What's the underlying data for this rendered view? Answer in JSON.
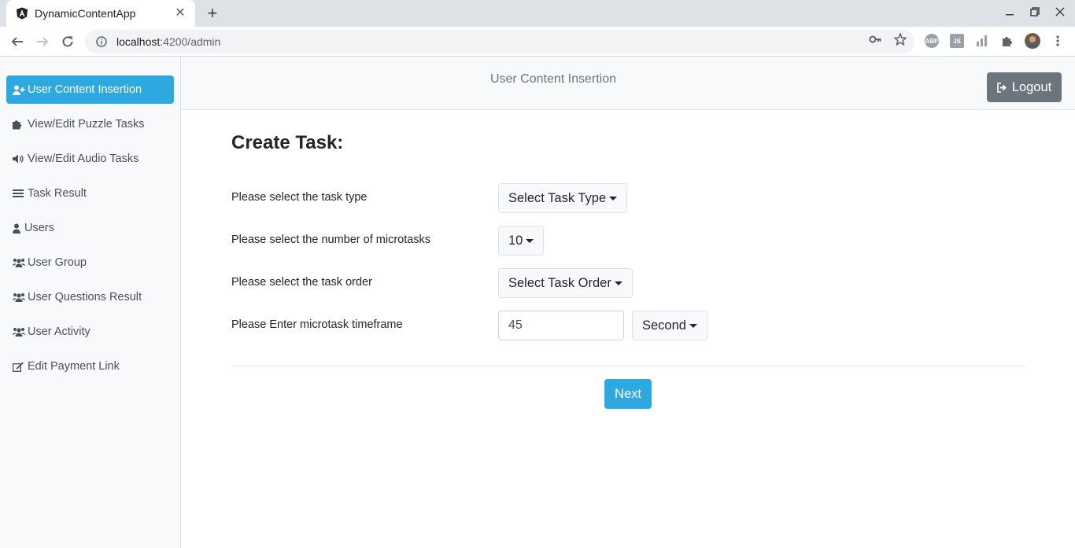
{
  "browser": {
    "tab_title": "DynamicContentApp",
    "tab_close": "✕",
    "new_tab": "+",
    "url_host": "localhost",
    "url_path": ":4200/admin",
    "extensions": [
      "ABP",
      "JS"
    ]
  },
  "sidebar": {
    "items": [
      {
        "label": "User Content Insertion",
        "icon": "user-plus-icon",
        "active": true
      },
      {
        "label": "View/Edit Puzzle Tasks",
        "icon": "puzzle-icon",
        "active": false
      },
      {
        "label": "View/Edit Audio Tasks",
        "icon": "volume-icon",
        "active": false
      },
      {
        "label": "Task Result",
        "icon": "list-icon",
        "active": false
      },
      {
        "label": "Users",
        "icon": "user-icon",
        "active": false
      },
      {
        "label": "User Group",
        "icon": "users-icon",
        "active": false
      },
      {
        "label": "User Questions Result",
        "icon": "users-icon",
        "active": false
      },
      {
        "label": "User Activity",
        "icon": "users-icon",
        "active": false
      },
      {
        "label": "Edit Payment Link",
        "icon": "edit-icon",
        "active": false
      }
    ]
  },
  "header": {
    "title": "User Content Insertion",
    "logout_label": "Logout"
  },
  "form": {
    "title": "Create Task:",
    "task_type_label": "Please select the task type",
    "task_type_value": "Select Task Type",
    "microtasks_label": "Please select the number of microtasks",
    "microtasks_value": "10",
    "task_order_label": "Please select the task order",
    "task_order_value": "Select Task Order",
    "timeframe_label": "Please Enter microtask timeframe",
    "timeframe_value": "45",
    "timeframe_unit": "Second",
    "next_label": "Next"
  },
  "colors": {
    "accent": "#2ea9df",
    "secondary": "#6c757d"
  }
}
